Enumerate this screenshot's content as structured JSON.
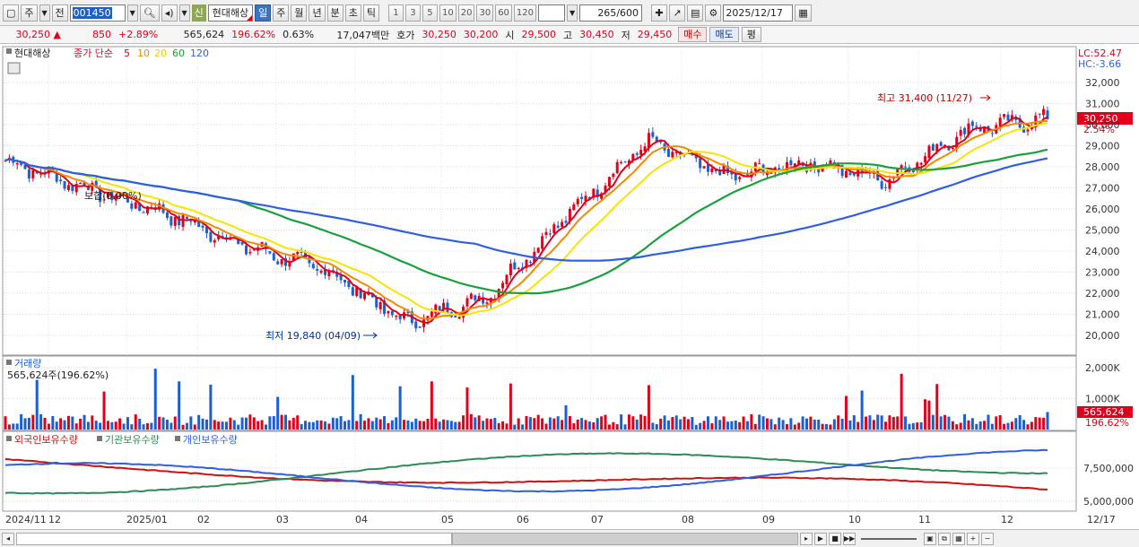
{
  "toolbar": {
    "period_label": "주",
    "type_label": "전",
    "stock_code": "001450",
    "stock_name": "현대해상",
    "badge": "신",
    "period_tabs": [
      "일",
      "주",
      "월",
      "년",
      "분",
      "초",
      "틱"
    ],
    "active_tab": "일",
    "intervals": [
      "1",
      "3",
      "5",
      "10",
      "20",
      "30",
      "60",
      "120"
    ],
    "bar_count": "265",
    "bar_total": "/600",
    "date": "2025/12/17"
  },
  "quote": {
    "price": "30,250",
    "direction": "▲",
    "change": "850",
    "change_pct": "+2.89%",
    "volume": "565,624",
    "volume_ratio": "196.62%",
    "turnover_pct": "0.63%",
    "amount": "17,047백만",
    "ask_label": "호가",
    "ask": "30,250",
    "bid": "30,200",
    "open_label": "시",
    "open": "29,500",
    "high_label": "고",
    "high": "30,450",
    "low_label": "저",
    "low": "29,450",
    "buy_label": "매수",
    "sell_label": "매도",
    "flat_label": "평"
  },
  "price_panel": {
    "legend_name": "현대해상",
    "legend_desc": "종가 단순",
    "ma": [
      "5",
      "10",
      "20",
      "60",
      "120"
    ],
    "lc": "LC:52.47",
    "hc": "HC:-3.66",
    "y_ticks": [
      "32,000",
      "31,000",
      "30,000",
      "29,000",
      "28,000",
      "27,000",
      "26,000",
      "25,000",
      "24,000",
      "23,000",
      "22,000",
      "21,000",
      "20,000"
    ],
    "current_price": "30,250",
    "current_pct": "2.54%",
    "high_annotation": "최고 31,400 (11/27)",
    "low_annotation": "최저 19,840 (04/09)",
    "flat_annotation": "보합(0.00%)"
  },
  "volume_panel": {
    "title": "거래량",
    "value_text": "565,624주(196.62%)",
    "y_ticks": [
      "2,000K",
      "1,000K"
    ],
    "current": "565,624",
    "current_pct": "196.62%"
  },
  "holder_panel": {
    "series": [
      "외국인보유수량",
      "기관보유수량",
      "개인보유수량"
    ],
    "y_ticks": [
      "7,500,000",
      "5,000,000"
    ]
  },
  "x_axis": {
    "labels": [
      "2024/11",
      "12",
      "2025/01",
      "02",
      "03",
      "04",
      "05",
      "06",
      "07",
      "08",
      "09",
      "10",
      "11",
      "12"
    ],
    "right_label": "12/17"
  },
  "colors": {
    "up": "#e0001b",
    "down": "#1c5fd1",
    "ma5": "#e0001b",
    "ma10": "#f08a00",
    "ma20": "#f5e400",
    "ma60": "#1aa03a",
    "ma120": "#2f5fe0",
    "foreign": "#d01010",
    "institution": "#2e8b57",
    "individual": "#2f5fe0"
  },
  "chart_data": {
    "type": "candlestick",
    "price_series_key_points": [
      {
        "x": "2024/11",
        "y": 28300
      },
      {
        "x": "2024/12",
        "y": 27000
      },
      {
        "x": "2025/01",
        "y": 25800
      },
      {
        "x": "2025/02",
        "y": 24200
      },
      {
        "x": "2025/03",
        "y": 23100
      },
      {
        "x": "2025/04",
        "y": 20600
      },
      {
        "x": "2025/05",
        "y": 21800
      },
      {
        "x": "2025/06",
        "y": 25700
      },
      {
        "x": "2025/07",
        "y": 29200
      },
      {
        "x": "2025/08",
        "y": 27500
      },
      {
        "x": "2025/09",
        "y": 28200
      },
      {
        "x": "2025/10",
        "y": 27400
      },
      {
        "x": "2025/11",
        "y": 29800
      },
      {
        "x": "2025/12",
        "y": 30250
      }
    ],
    "ylim": [
      19600,
      32600
    ],
    "high": {
      "value": 31400,
      "date": "11/27"
    },
    "low": {
      "value": 19840,
      "date": "04/09"
    }
  }
}
